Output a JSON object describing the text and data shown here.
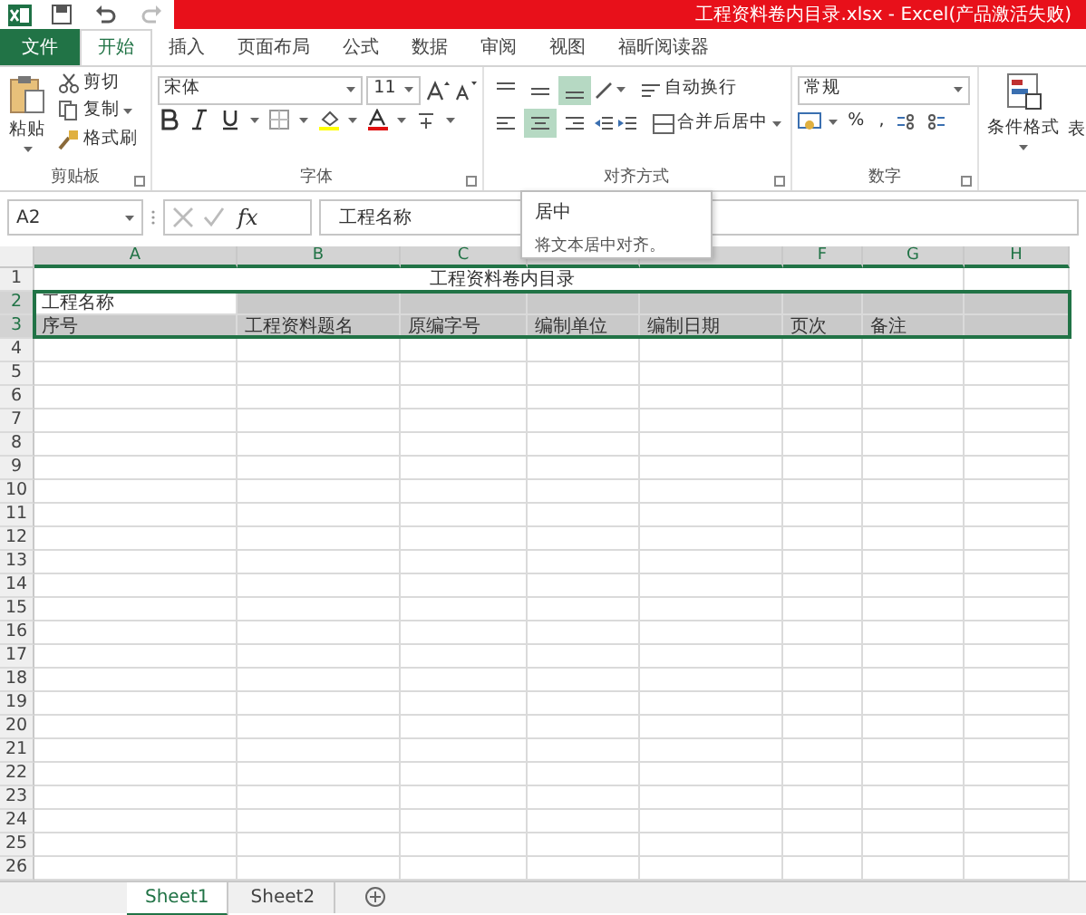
{
  "title_bar": {
    "title": "工程资料卷内目录.xlsx - Excel(产品激活失败)"
  },
  "tabs": [
    {
      "label": "文件",
      "kind": "file",
      "selected": false
    },
    {
      "label": "开始",
      "kind": "tab",
      "selected": true
    },
    {
      "label": "插入",
      "kind": "tab",
      "selected": false
    },
    {
      "label": "页面布局",
      "kind": "tab",
      "selected": false
    },
    {
      "label": "公式",
      "kind": "tab",
      "selected": false
    },
    {
      "label": "数据",
      "kind": "tab",
      "selected": false
    },
    {
      "label": "审阅",
      "kind": "tab",
      "selected": false
    },
    {
      "label": "视图",
      "kind": "tab",
      "selected": false
    },
    {
      "label": "福昕阅读器",
      "kind": "tab",
      "selected": false
    }
  ],
  "ribbon": {
    "clipboard": {
      "paste": "粘贴",
      "items": [
        "剪切",
        "复制",
        "格式刷"
      ],
      "label": "剪贴板"
    },
    "font": {
      "font_name": "宋体",
      "font_size": "11",
      "label": "字体"
    },
    "alignment": {
      "vertical": [
        {
          "selected": false
        },
        {
          "selected": false
        },
        {
          "selected": true
        }
      ],
      "horizontal": [
        {
          "selected": false
        },
        {
          "selected": true
        },
        {
          "selected": false
        }
      ],
      "wrap": "自动换行",
      "merge": "合并后居中",
      "label": "对齐方式"
    },
    "number": {
      "format": "常规",
      "percent": "%",
      "comma": ",",
      "label": "数字"
    },
    "styles": {
      "conditional": "条件格式",
      "next": "表"
    }
  },
  "formula_bar": {
    "name_box": "A2",
    "fx": "fx",
    "value": "工程名称"
  },
  "tooltip": {
    "title": "居中",
    "text": "将文本居中对齐。"
  },
  "sheet": {
    "columns": [
      {
        "header": "A",
        "selected": true
      },
      {
        "header": "B",
        "selected": true
      },
      {
        "header": "C",
        "selected": true
      },
      {
        "selected": true
      },
      {
        "selected": true
      },
      {
        "header": "F",
        "selected": true
      },
      {
        "header": "G",
        "selected": true
      },
      {
        "header": "H",
        "selected": true
      }
    ],
    "rows": [
      {
        "header": "1",
        "selected": false,
        "title": "工程资料卷内目录"
      },
      {
        "header": "2",
        "selected": true,
        "cells": [
          {
            "text": "工程名称",
            "shaded": false
          },
          {
            "shaded": true
          },
          {
            "shaded": true
          },
          {
            "shaded": true
          },
          {
            "shaded": true
          },
          {
            "shaded": true
          },
          {
            "shaded": true
          },
          {
            "shaded": true
          }
        ]
      },
      {
        "header": "3",
        "selected": true,
        "cells": [
          {
            "text": "序号",
            "shaded": true
          },
          {
            "text": "工程资料题名",
            "shaded": true
          },
          {
            "text": "原编字号",
            "shaded": true
          },
          {
            "text": "编制单位",
            "shaded": true
          },
          {
            "text": "编制日期",
            "shaded": true
          },
          {
            "text": "页次",
            "shaded": true
          },
          {
            "text": "备注",
            "shaded": true
          },
          {
            "shaded": true
          }
        ]
      },
      {
        "header": "4",
        "selected": false
      },
      {
        "header": "5",
        "selected": false
      },
      {
        "header": "6",
        "selected": false
      },
      {
        "header": "7",
        "selected": false
      },
      {
        "header": "8",
        "selected": false
      },
      {
        "header": "9",
        "selected": false
      },
      {
        "header": "10",
        "selected": false
      },
      {
        "header": "11",
        "selected": false
      },
      {
        "header": "12",
        "selected": false
      },
      {
        "header": "13",
        "selected": false
      },
      {
        "header": "14",
        "selected": false
      },
      {
        "header": "15",
        "selected": false
      },
      {
        "header": "16",
        "selected": false
      },
      {
        "header": "17",
        "selected": false
      },
      {
        "header": "18",
        "selected": false
      },
      {
        "header": "19",
        "selected": false
      },
      {
        "header": "20",
        "selected": false
      },
      {
        "header": "21",
        "selected": false
      },
      {
        "header": "22",
        "selected": false
      },
      {
        "header": "23",
        "selected": false
      },
      {
        "header": "24",
        "selected": false
      },
      {
        "header": "25",
        "selected": false
      },
      {
        "header": "26",
        "selected": false
      }
    ]
  },
  "sheet_tabs": [
    {
      "label": "Sheet1",
      "selected": true
    },
    {
      "label": "Sheet2",
      "selected": false
    }
  ]
}
